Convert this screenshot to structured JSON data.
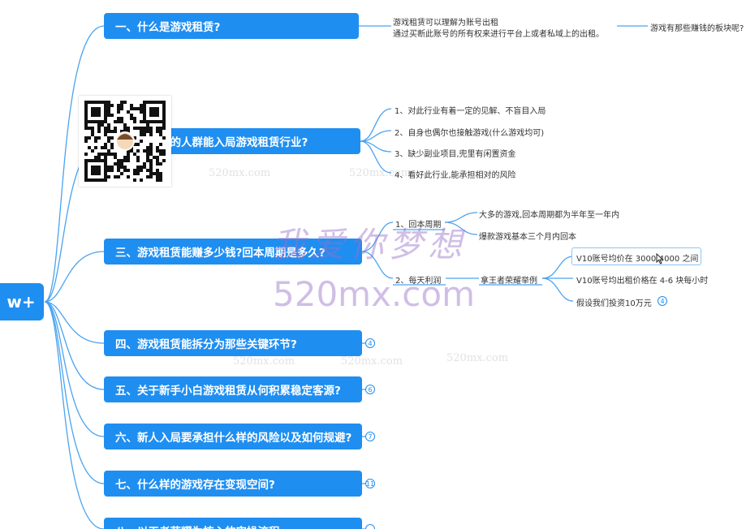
{
  "root": {
    "label": "w+"
  },
  "topics": [
    {
      "label": "一、什么是游戏租赁?",
      "badge": ""
    },
    {
      "label": "二、什么样的人群能入局游戏租赁行业?",
      "badge": ""
    },
    {
      "label": "三、游戏租赁能赚多少钱?回本周期是多久?",
      "badge": ""
    },
    {
      "label": "四、游戏租赁能拆分为那些关键环节?",
      "badge": "4"
    },
    {
      "label": "五、关于新手小白游戏租赁从何积累稳定客源?",
      "badge": "6"
    },
    {
      "label": "六、新人入局要承担什么样的风险以及如何规避?",
      "badge": "7"
    },
    {
      "label": "七、什么样的游戏存在变现空间?",
      "badge": "11"
    },
    {
      "label": "八、以王者荣耀为核心的实操流程",
      "badge": "~"
    }
  ],
  "topic1": {
    "desc_line1": "游戏租赁可以理解为账号出租",
    "desc_line2": "通过买断此账号的所有权来进行平台上或者私域上的出租。",
    "next": "游戏有那些赚钱的板块呢?"
  },
  "topic2": {
    "items": [
      "1、对此行业有着一定的见解、不盲目入局",
      "2、自身也偶尔也接触游戏(什么游戏均可)",
      "3、缺少副业项目,兜里有闲置资金",
      "4、看好此行业,能承担相对的风险"
    ]
  },
  "topic3": {
    "cycle_label": "1、回本周期",
    "cycle_items": [
      "大多的游戏,回本周期都为半年至一年内",
      "爆款游戏基本三个月内回本"
    ],
    "profit_label": "2、每天利润",
    "example_label": "拿王者荣耀举例",
    "example_items": [
      "V10账号均价在 3000-4000 之间",
      "V10账号均出租价格在 4-6 块每小时",
      "假设我们投资10万元"
    ],
    "example_badge": "4"
  },
  "watermarks": {
    "cn": "我爱你梦想",
    "big": "520mx.com",
    "small": "520mx.com"
  },
  "colors": {
    "accent": "#1f8ef1",
    "line": "#4aa3f0"
  }
}
